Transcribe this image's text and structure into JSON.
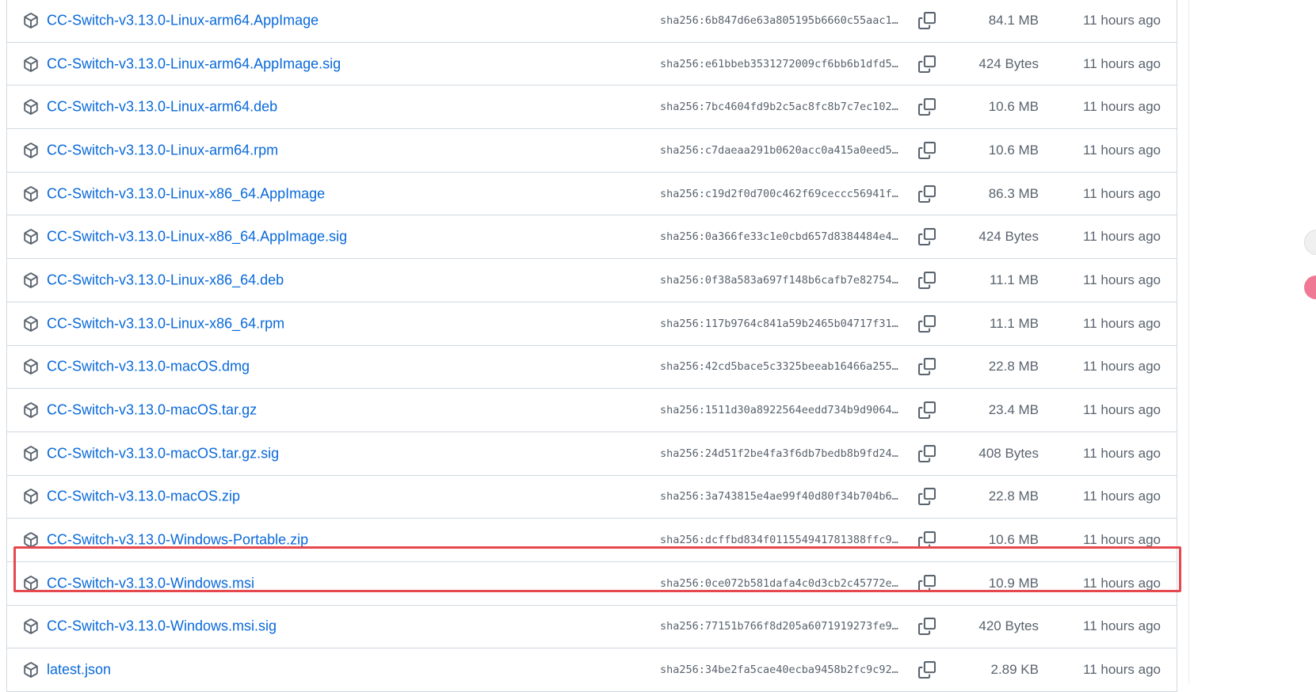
{
  "accent": "#0969da",
  "highlight_color": "#e5484d",
  "assets": [
    {
      "name": "CC-Switch-v3.13.0-Linux-arm64.AppImage",
      "hash": "sha256:6b847d6e63a805195b6660c55aac1…",
      "size": "84.1 MB",
      "time": "11 hours ago",
      "icon": "package-icon"
    },
    {
      "name": "CC-Switch-v3.13.0-Linux-arm64.AppImage.sig",
      "hash": "sha256:e61bbeb3531272009cf6bb6b1dfd5…",
      "size": "424 Bytes",
      "time": "11 hours ago",
      "icon": "package-icon"
    },
    {
      "name": "CC-Switch-v3.13.0-Linux-arm64.deb",
      "hash": "sha256:7bc4604fd9b2c5ac8fc8b7c7ec102…",
      "size": "10.6 MB",
      "time": "11 hours ago",
      "icon": "package-icon"
    },
    {
      "name": "CC-Switch-v3.13.0-Linux-arm64.rpm",
      "hash": "sha256:c7daeaa291b0620acc0a415a0eed5…",
      "size": "10.6 MB",
      "time": "11 hours ago",
      "icon": "package-icon"
    },
    {
      "name": "CC-Switch-v3.13.0-Linux-x86_64.AppImage",
      "hash": "sha256:c19d2f0d700c462f69ceccc56941f…",
      "size": "86.3 MB",
      "time": "11 hours ago",
      "icon": "package-icon"
    },
    {
      "name": "CC-Switch-v3.13.0-Linux-x86_64.AppImage.sig",
      "hash": "sha256:0a366fe33c1e0cbd657d8384484e4…",
      "size": "424 Bytes",
      "time": "11 hours ago",
      "icon": "package-icon"
    },
    {
      "name": "CC-Switch-v3.13.0-Linux-x86_64.deb",
      "hash": "sha256:0f38a583a697f148b6cafb7e82754…",
      "size": "11.1 MB",
      "time": "11 hours ago",
      "icon": "package-icon"
    },
    {
      "name": "CC-Switch-v3.13.0-Linux-x86_64.rpm",
      "hash": "sha256:117b9764c841a59b2465b04717f31…",
      "size": "11.1 MB",
      "time": "11 hours ago",
      "icon": "package-icon"
    },
    {
      "name": "CC-Switch-v3.13.0-macOS.dmg",
      "hash": "sha256:42cd5bace5c3325beeab16466a255…",
      "size": "22.8 MB",
      "time": "11 hours ago",
      "icon": "package-icon"
    },
    {
      "name": "CC-Switch-v3.13.0-macOS.tar.gz",
      "hash": "sha256:1511d30a8922564eedd734b9d9064…",
      "size": "23.4 MB",
      "time": "11 hours ago",
      "icon": "package-icon"
    },
    {
      "name": "CC-Switch-v3.13.0-macOS.tar.gz.sig",
      "hash": "sha256:24d51f2be4fa3f6db7bedb8b9fd24…",
      "size": "408 Bytes",
      "time": "11 hours ago",
      "icon": "package-icon"
    },
    {
      "name": "CC-Switch-v3.13.0-macOS.zip",
      "hash": "sha256:3a743815e4ae99f40d80f34b704b6…",
      "size": "22.8 MB",
      "time": "11 hours ago",
      "icon": "package-icon"
    },
    {
      "name": "CC-Switch-v3.13.0-Windows-Portable.zip",
      "hash": "sha256:dcffbd834f011554941781388ffc9…",
      "size": "10.6 MB",
      "time": "11 hours ago",
      "icon": "package-icon"
    },
    {
      "name": "CC-Switch-v3.13.0-Windows.msi",
      "hash": "sha256:0ce072b581dafa4c0d3cb2c45772e…",
      "size": "10.9 MB",
      "time": "11 hours ago",
      "icon": "package-icon",
      "highlighted": true
    },
    {
      "name": "CC-Switch-v3.13.0-Windows.msi.sig",
      "hash": "sha256:77151b766f8d205a6071919273fe9…",
      "size": "420 Bytes",
      "time": "11 hours ago",
      "icon": "package-icon"
    },
    {
      "name": "latest.json",
      "hash": "sha256:34be2fa5cae40ecba9458b2fc9c92…",
      "size": "2.89 KB",
      "time": "11 hours ago",
      "icon": "package-icon"
    }
  ]
}
